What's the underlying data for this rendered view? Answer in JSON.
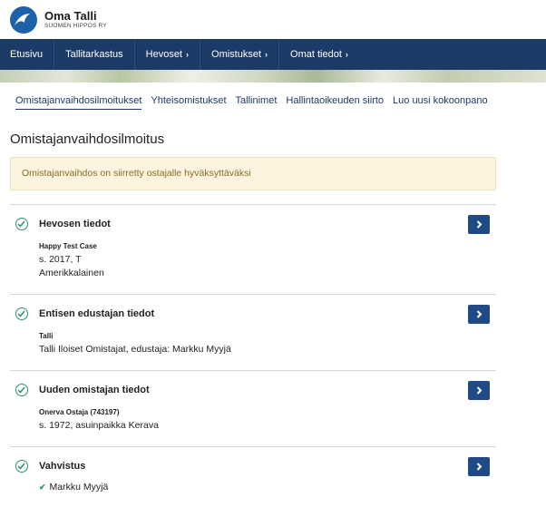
{
  "brand": {
    "name": "Oma Talli",
    "subtitle": "SUOMEN HIPPOS RY"
  },
  "nav": {
    "items": [
      {
        "label": "Etusivu",
        "has_chevron": false
      },
      {
        "label": "Tallitarkastus",
        "has_chevron": false
      },
      {
        "label": "Hevoset",
        "has_chevron": true
      },
      {
        "label": "Omistukset",
        "has_chevron": true
      },
      {
        "label": "Omat tiedot",
        "has_chevron": true
      }
    ]
  },
  "subnav": {
    "items": [
      {
        "label": "Omistajanvaihdosilmoitukset",
        "active": true
      },
      {
        "label": "Yhteisomistukset",
        "active": false
      },
      {
        "label": "Tallinimet",
        "active": false
      },
      {
        "label": "Hallintaoikeuden siirto",
        "active": false
      },
      {
        "label": "Luo uusi kokoonpano",
        "active": false
      }
    ]
  },
  "page": {
    "title": "Omistajanvaihdosilmoitus"
  },
  "alert": {
    "text": "Omistajanvaihdos on siirretty ostajalle hyväksyttäväksi"
  },
  "sections": {
    "horse": {
      "title": "Hevosen tiedot",
      "name": "Happy Test Case",
      "birth": "s. 2017, T",
      "breed": "Amerikkalainen"
    },
    "previous_rep": {
      "title": "Entisen edustajan tiedot",
      "type": "Talli",
      "details": "Talli Iloiset Omistajat, edustaja: Markku Myyjä"
    },
    "new_owner": {
      "title": "Uuden omistajan tiedot",
      "name": "Onerva Ostaja (743197)",
      "details": "s. 1972, asuinpaikka Kerava"
    },
    "confirmation": {
      "title": "Vahvistus",
      "signer": "Markku Myyjä"
    }
  },
  "colors": {
    "nav_bg": "#1c3a66",
    "button_bg": "#1f4a86",
    "check_green": "#2f8f6b",
    "alert_bg": "#fcf4df",
    "alert_text": "#8a6a22"
  },
  "icons": {
    "logo": "hippos-logo",
    "section_status": "check-circle-icon",
    "section_action": "chevron-right-icon"
  }
}
